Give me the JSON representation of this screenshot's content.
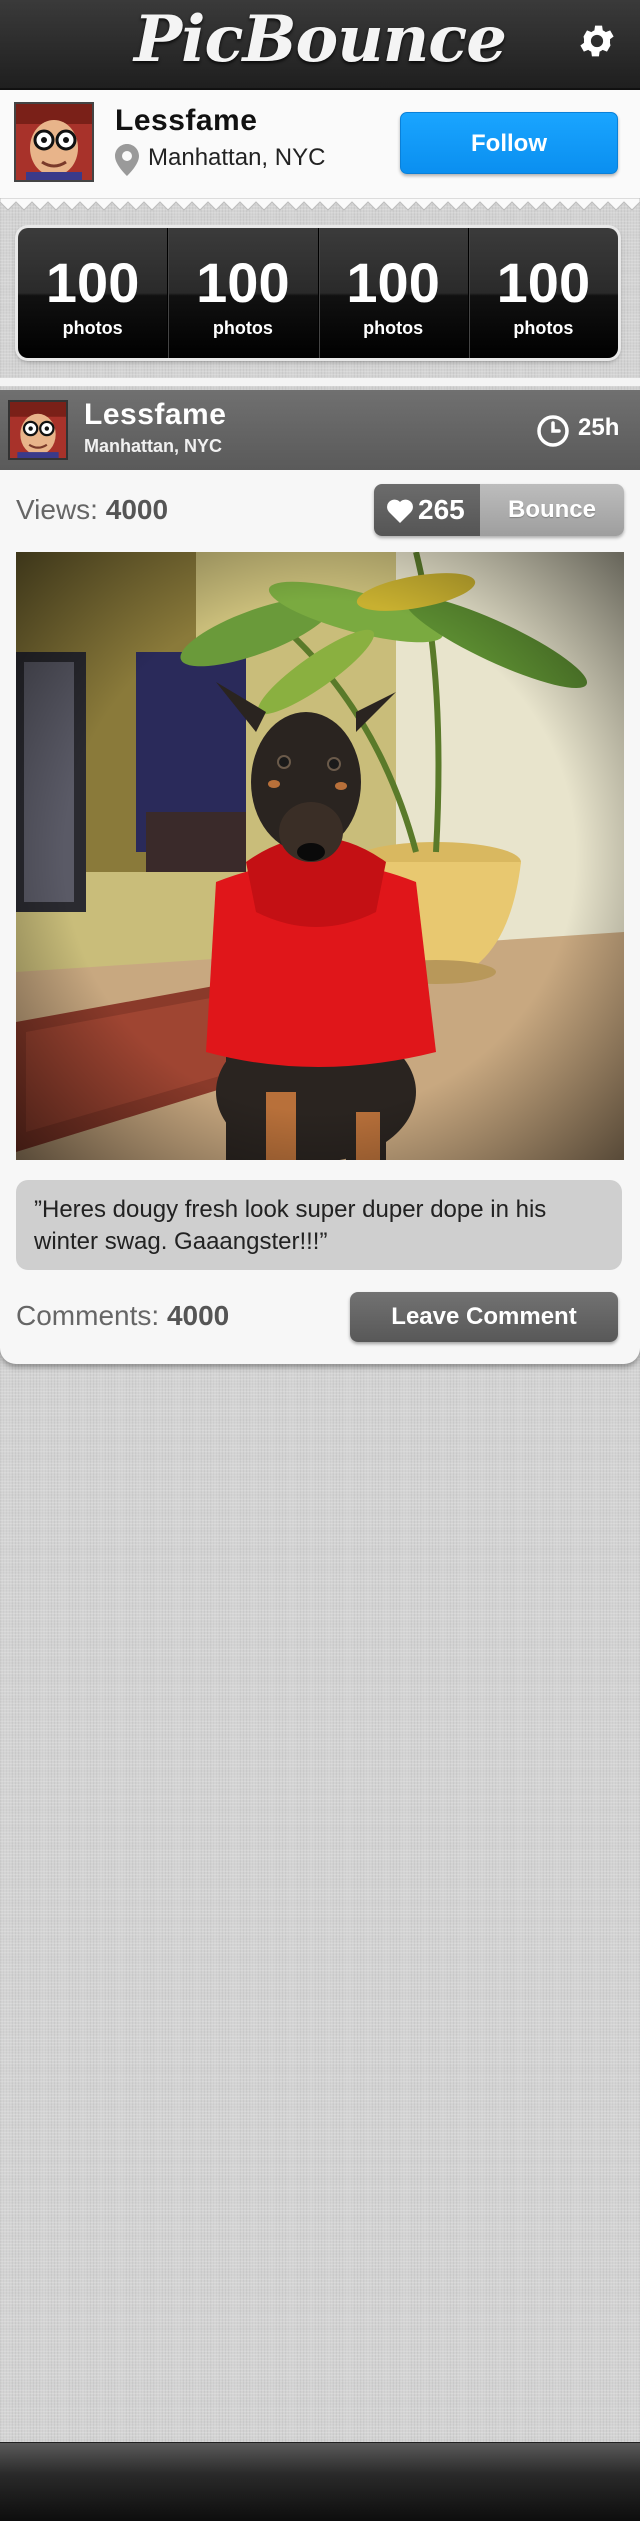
{
  "app": {
    "title": "PicBounce"
  },
  "profile": {
    "name": "Lessfame",
    "location": "Manhattan, NYC",
    "follow_label": "Follow"
  },
  "stats": [
    {
      "value": "100",
      "label": "photos"
    },
    {
      "value": "100",
      "label": "photos"
    },
    {
      "value": "100",
      "label": "photos"
    },
    {
      "value": "100",
      "label": "photos"
    }
  ],
  "post": {
    "user_name": "Lessfame",
    "user_location": "Manhattan, NYC",
    "time_ago": "25h",
    "views_label": "Views:",
    "views_value": "4000",
    "likes": "265",
    "bounce_label": "Bounce",
    "caption": "”Heres dougy fresh look super duper dope in his winter swag. Gaaangster!!!”",
    "comments_label": "Comments:",
    "comments_value": "4000",
    "leave_comment_label": "Leave Comment"
  },
  "icons": {
    "settings": "gear-icon",
    "location": "map-pin-icon",
    "time": "clock-icon",
    "like": "heart-icon"
  },
  "colors": {
    "follow_blue": "#0a98f5",
    "top_bar": "#2a2a2a",
    "card_header": "#666666"
  }
}
